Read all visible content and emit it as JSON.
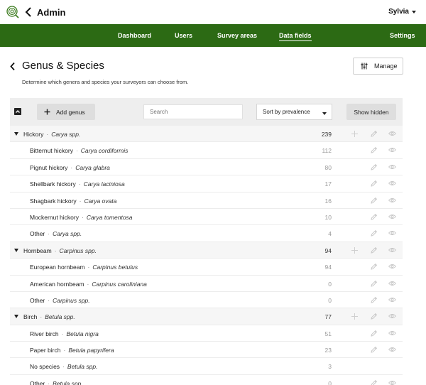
{
  "header": {
    "title": "Admin",
    "user": "Sylvia"
  },
  "nav": [
    {
      "label": "Dashboard",
      "active": false
    },
    {
      "label": "Users",
      "active": false
    },
    {
      "label": "Survey areas",
      "active": false
    },
    {
      "label": "Data fields",
      "active": true
    },
    {
      "label": "Settings",
      "active": false
    }
  ],
  "page": {
    "title": "Genus & Species",
    "subtitle": "Determine which genera and species your surveyors can choose from.",
    "manage_label": "Manage"
  },
  "toolbar": {
    "add_genus_label": "Add genus",
    "search_placeholder": "Search",
    "sort_label": "Sort by prevalence",
    "show_hidden_label": "Show hidden"
  },
  "rows": [
    {
      "kind": "genus",
      "name": "Hickory",
      "sci": "Carya spp.",
      "count": "239"
    },
    {
      "kind": "species",
      "name": "Bitternut hickory",
      "sci": "Carya cordiformis",
      "count": "112"
    },
    {
      "kind": "species",
      "name": "Pignut hickory",
      "sci": "Carya glabra",
      "count": "80"
    },
    {
      "kind": "species",
      "name": "Shellbark hickory",
      "sci": "Carya laciniosa",
      "count": "17"
    },
    {
      "kind": "species",
      "name": "Shagbark hickory",
      "sci": "Carya ovata",
      "count": "16"
    },
    {
      "kind": "species",
      "name": "Mockernut hickory",
      "sci": "Carya tomentosa",
      "count": "10"
    },
    {
      "kind": "species",
      "name": "Other",
      "sci": "Carya spp.",
      "count": "4"
    },
    {
      "kind": "genus",
      "name": "Hornbeam",
      "sci": "Carpinus spp.",
      "count": "94"
    },
    {
      "kind": "species",
      "name": "European hornbeam",
      "sci": "Carpinus betulus",
      "count": "94"
    },
    {
      "kind": "species",
      "name": "American hornbeam",
      "sci": "Carpinus caroliniana",
      "count": "0"
    },
    {
      "kind": "species",
      "name": "Other",
      "sci": "Carpinus spp.",
      "count": "0"
    },
    {
      "kind": "genus",
      "name": "Birch",
      "sci": "Betula spp.",
      "count": "77"
    },
    {
      "kind": "species",
      "name": "River birch",
      "sci": "Betula nigra",
      "count": "51"
    },
    {
      "kind": "species",
      "name": "Paper birch",
      "sci": "Betula papyrifera",
      "count": "23"
    },
    {
      "kind": "species",
      "name": "No species",
      "sci": "Betula spp.",
      "count": "3",
      "noIcons": true
    },
    {
      "kind": "species",
      "name": "Other",
      "sci": "Betula spp.",
      "count": "0"
    }
  ]
}
